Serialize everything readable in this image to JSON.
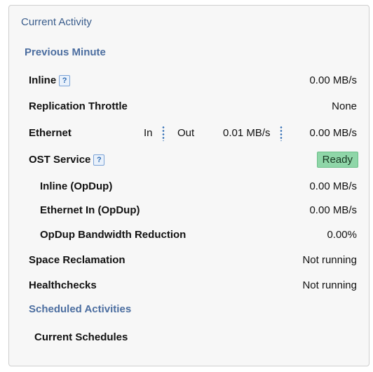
{
  "panel": {
    "title": "Current Activity",
    "previous_minute": "Previous Minute",
    "scheduled_activities": "Scheduled Activities"
  },
  "rows": {
    "inline": {
      "label": "Inline",
      "value": "0.00 MB/s",
      "help": "?"
    },
    "replication_throttle": {
      "label": "Replication Throttle",
      "value": "None"
    },
    "ethernet": {
      "label": "Ethernet",
      "in_label": "In",
      "out_label": "Out",
      "in_value": "0.01 MB/s",
      "out_value": "0.00 MB/s"
    },
    "ost_service": {
      "label": "OST Service",
      "status": "Ready",
      "help": "?"
    },
    "inline_opdup": {
      "label": "Inline (OpDup)",
      "value": "0.00 MB/s"
    },
    "ethernet_in_opdup": {
      "label": "Ethernet In (OpDup)",
      "value": "0.00 MB/s"
    },
    "opdup_bandwidth_reduction": {
      "label": "OpDup Bandwidth Reduction",
      "value": "0.00%"
    },
    "space_reclamation": {
      "label": "Space Reclamation",
      "value": "Not running"
    },
    "healthchecks": {
      "label": "Healthchecks",
      "value": "Not running"
    },
    "current_schedules": {
      "label": "Current Schedules"
    }
  },
  "colors": {
    "section_heading": "#4c6ea0",
    "ready_badge": "#8fd6a8",
    "help_icon": "#2f6cb4"
  },
  "icons": {
    "help": "help-icon"
  }
}
